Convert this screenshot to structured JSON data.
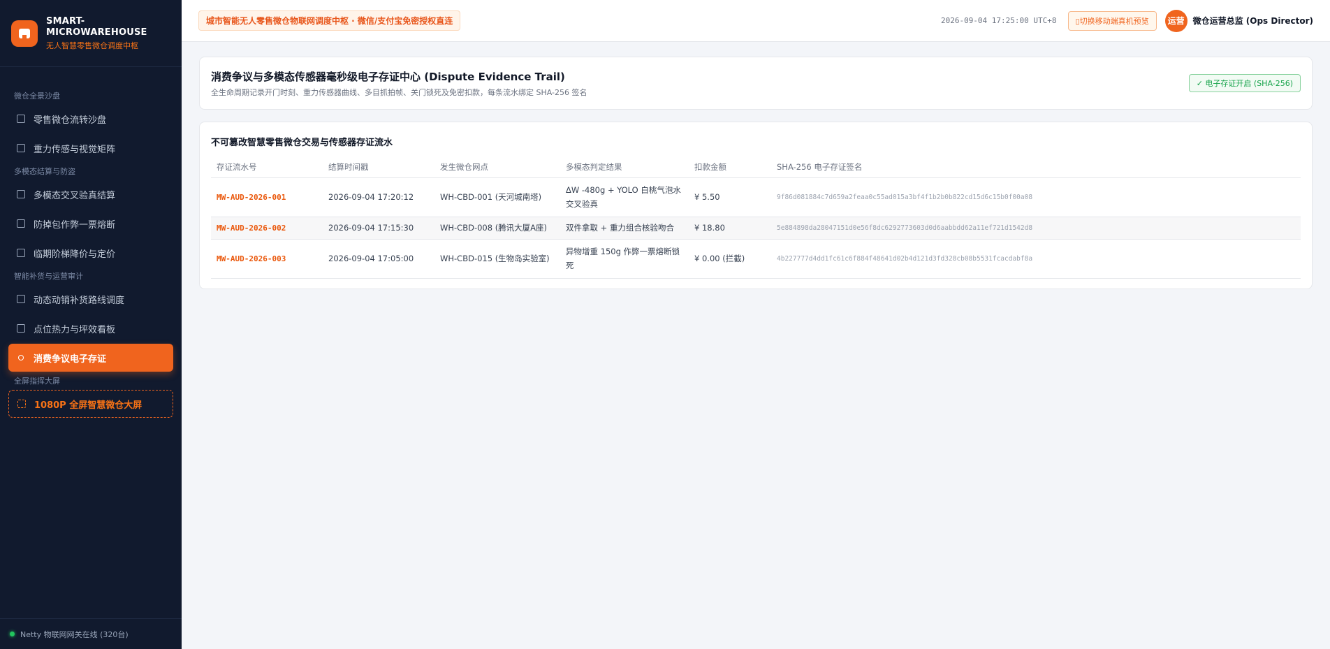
{
  "brand": {
    "title": "SMART-MICROWAREHOUSE",
    "subtitle": "无人智慧零售微仓调度中枢"
  },
  "sidebar": {
    "groups": [
      {
        "label": "微仓全景沙盘",
        "items": [
          {
            "label": "零售微仓流转沙盘",
            "icon": "store-icon"
          },
          {
            "label": "重力传感与视觉矩阵",
            "icon": "chip-icon"
          }
        ]
      },
      {
        "label": "多模态结算与防盗",
        "items": [
          {
            "label": "多模态交叉验真结算",
            "icon": "scan-icon"
          },
          {
            "label": "防掉包作弊一票熔断",
            "icon": "lock-icon"
          },
          {
            "label": "临期阶梯降价与定价",
            "icon": "clipboard-icon"
          }
        ]
      },
      {
        "label": "智能补货与运营审计",
        "items": [
          {
            "label": "动态动销补货路线调度",
            "icon": "truck-icon"
          },
          {
            "label": "点位热力与坪效看板",
            "icon": "pie-chart-icon"
          },
          {
            "label": "消费争议电子存证",
            "icon": "user-icon",
            "active": true
          }
        ]
      },
      {
        "label": "全屏指挥大屏",
        "items": [
          {
            "label": "1080P 全屏智慧微仓大屏",
            "icon": "fullscreen-icon"
          }
        ]
      }
    ],
    "footer": "Netty 物联网网关在线 (320台)"
  },
  "topbar": {
    "notice": "城市智能无人零售微仓物联网调度中枢 · 微信/支付宝免密授权直连",
    "clock": "2026-09-04 17:25:00 UTC+8",
    "mobile_button": "切换移动端真机预览",
    "avatar": "运营",
    "user": "微仓运营总监 (Ops Director)"
  },
  "header": {
    "title": "消费争议与多模态传感器毫秒级电子存证中心 (Dispute Evidence Trail)",
    "subtitle": "全生命周期记录开门时刻、重力传感器曲线、多目抓拍帧、关门锁死及免密扣款，每条流水绑定 SHA-256 签名",
    "badge": "✓  电子存证开启 (SHA-256)"
  },
  "table": {
    "title": "不可篡改智慧零售微仓交易与传感器存证流水",
    "columns": [
      "存证流水号",
      "结算时间戳",
      "发生微仓网点",
      "多模态判定结果",
      "扣款金额",
      "SHA-256 电子存证签名"
    ],
    "rows": [
      {
        "id": "MW-AUD-2026-001",
        "time": "2026-09-04 17:20:12",
        "site": "WH-CBD-001 (天河城南塔)",
        "verdict": "ΔW -480g + YOLO 白桃气泡水交叉验真",
        "amount": "¥ 5.50",
        "hash": "9f86d081884c7d659a2feaa0c55ad015a3bf4f1b2b0b822cd15d6c15b0f00a08"
      },
      {
        "id": "MW-AUD-2026-002",
        "time": "2026-09-04 17:15:30",
        "site": "WH-CBD-008 (腾讯大厦A座)",
        "verdict": "双件拿取 + 重力组合核验吻合",
        "amount": "¥ 18.80",
        "hash": "5e884898da28047151d0e56f8dc6292773603d0d6aabbdd62a11ef721d1542d8"
      },
      {
        "id": "MW-AUD-2026-003",
        "time": "2026-09-04 17:05:00",
        "site": "WH-CBD-015 (生物岛实验室)",
        "verdict": "异物增重 150g 作弊一票熔断锁死",
        "amount": "¥ 0.00 (拦截)",
        "hash": "4b227777d4dd1fc61c6f884f48641d02b4d121d3fd328cb08b5531fcacdabf8a"
      }
    ]
  }
}
